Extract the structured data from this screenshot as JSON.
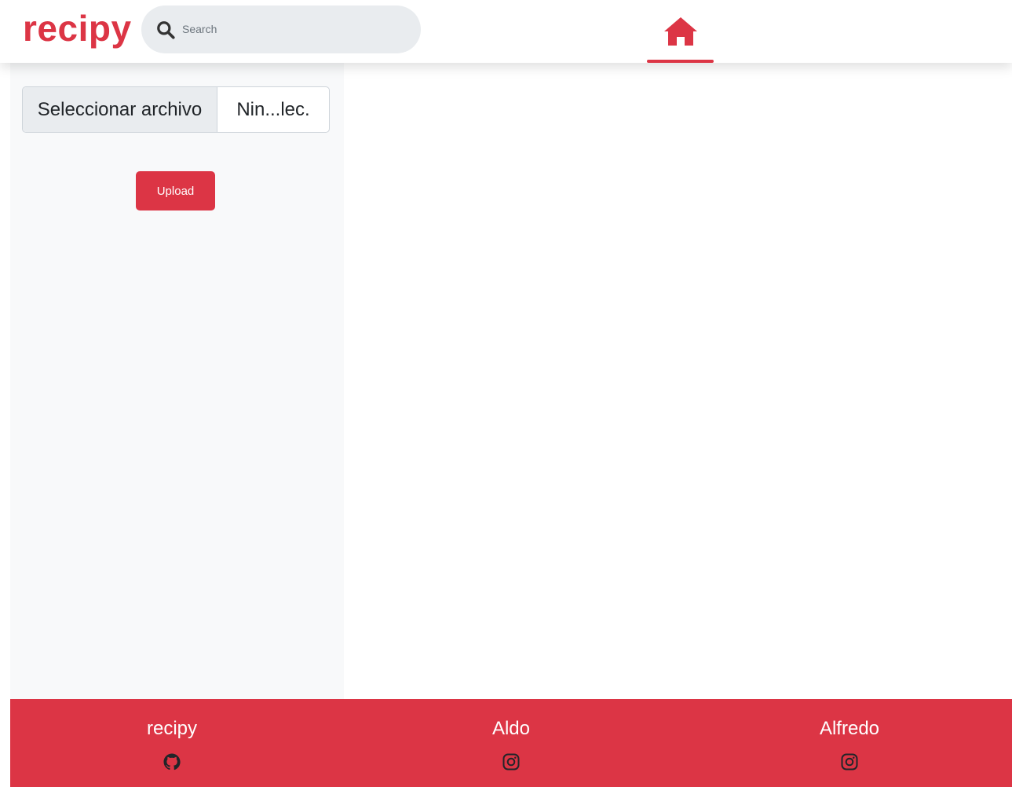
{
  "header": {
    "logo": "recipy",
    "search": {
      "placeholder": "Search",
      "value": ""
    },
    "nav": {
      "home_icon": "home-icon",
      "active": "home"
    }
  },
  "sidebar": {
    "file_input": {
      "button_label": "Seleccionar archivo",
      "file_name": "Nin...lec."
    },
    "upload_label": "Upload"
  },
  "footer": {
    "columns": [
      {
        "name": "recipy",
        "icon": "github-icon"
      },
      {
        "name": "Aldo",
        "icon": "instagram-icon"
      },
      {
        "name": "Alfredo",
        "icon": "instagram-icon"
      }
    ]
  },
  "colors": {
    "brand": "#dc3545",
    "sidebar_bg": "#f8f9fa",
    "search_bg": "#e9ecef"
  }
}
